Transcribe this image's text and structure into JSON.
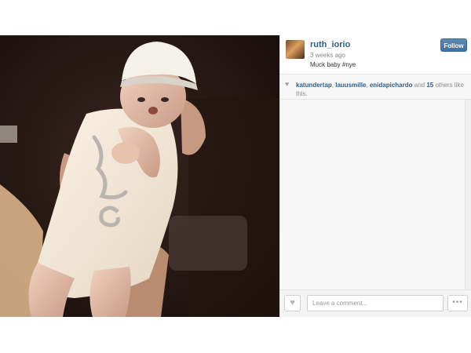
{
  "post": {
    "username": "ruth_iorio",
    "timestamp": "3 weeks ago",
    "caption": "Muck baby #nye",
    "follow_label": "Follow"
  },
  "likes": {
    "users": [
      "katundertap",
      "lauusmille",
      "enidapichardo"
    ],
    "separator": ", ",
    "and_text": " and ",
    "count": "15",
    "suffix": " others like this."
  },
  "footer": {
    "comment_placeholder": "Leave a comment...",
    "more_label": "•••"
  },
  "icons": {
    "heart": "heart-icon",
    "more": "more-options-icon"
  },
  "colors": {
    "link": "#2d5f8a",
    "follow_button": "#40729c",
    "muted_text": "#8a8a8a"
  }
}
